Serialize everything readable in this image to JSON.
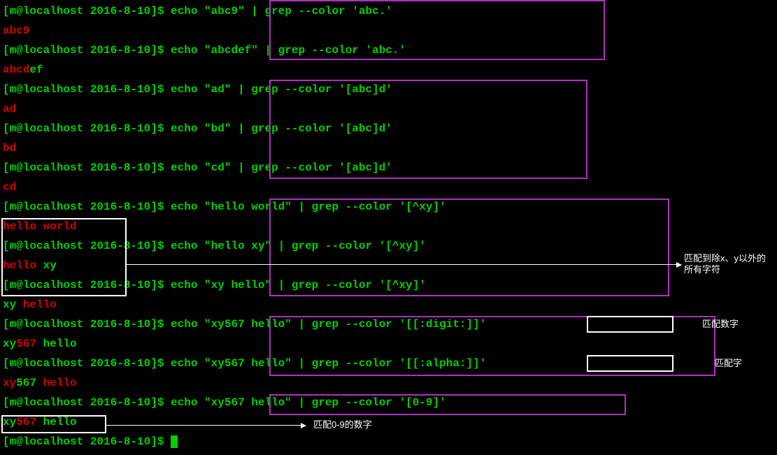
{
  "prompt": "[m@localhost 2016-8-10]$ ",
  "lines": [
    {
      "type": "cmd",
      "text": "echo \"abc9\" | grep --color 'abc.'"
    },
    {
      "type": "out",
      "parts": [
        {
          "t": "abc9",
          "c": "match"
        }
      ]
    },
    {
      "type": "cmd",
      "text": "echo \"abcdef\" | grep --color 'abc.'"
    },
    {
      "type": "out",
      "parts": [
        {
          "t": "abcd",
          "c": "match"
        },
        {
          "t": "ef",
          "c": "cmd"
        }
      ]
    },
    {
      "type": "cmd",
      "text": "echo \"ad\" | grep --color '[abc]d'"
    },
    {
      "type": "out",
      "parts": [
        {
          "t": "ad",
          "c": "match"
        }
      ]
    },
    {
      "type": "cmd",
      "text": "echo \"bd\" | grep --color '[abc]d'"
    },
    {
      "type": "out",
      "parts": [
        {
          "t": "bd",
          "c": "match"
        }
      ]
    },
    {
      "type": "cmd",
      "text": "echo \"cd\" | grep --color '[abc]d'"
    },
    {
      "type": "out",
      "parts": [
        {
          "t": "cd",
          "c": "match"
        }
      ]
    },
    {
      "type": "cmd",
      "text": "echo \"hello world\" | grep --color '[^xy]'"
    },
    {
      "type": "out",
      "parts": [
        {
          "t": "hello world",
          "c": "match"
        }
      ]
    },
    {
      "type": "cmd",
      "text": "echo \"hello xy\" | grep --color '[^xy]'"
    },
    {
      "type": "out",
      "parts": [
        {
          "t": "hello ",
          "c": "match"
        },
        {
          "t": "xy",
          "c": "cmd"
        }
      ]
    },
    {
      "type": "cmd",
      "text": "echo \"xy hello\" | grep --color '[^xy]'"
    },
    {
      "type": "out",
      "parts": [
        {
          "t": "xy",
          "c": "cmd"
        },
        {
          "t": " hello",
          "c": "match"
        }
      ]
    },
    {
      "type": "cmd",
      "text": "echo \"xy567 hello\" | grep --color '[[:digit:]]'"
    },
    {
      "type": "out",
      "parts": [
        {
          "t": "xy",
          "c": "cmd"
        },
        {
          "t": "567",
          "c": "match"
        },
        {
          "t": " hello",
          "c": "cmd"
        }
      ]
    },
    {
      "type": "cmd",
      "text": "echo \"xy567 hello\" | grep --color '[[:alpha:]]'"
    },
    {
      "type": "out",
      "parts": [
        {
          "t": "xy",
          "c": "match"
        },
        {
          "t": "567",
          "c": "cmd"
        },
        {
          "t": " ",
          "c": "cmd"
        },
        {
          "t": "hello",
          "c": "match"
        }
      ]
    },
    {
      "type": "cmd",
      "text": "echo \"xy567 hello\" | grep --color '[0-9]'"
    },
    {
      "type": "out",
      "parts": [
        {
          "t": "xy",
          "c": "cmd"
        },
        {
          "t": "567",
          "c": "match"
        },
        {
          "t": " hello",
          "c": "cmd"
        }
      ]
    },
    {
      "type": "cursor"
    }
  ],
  "annotations": {
    "neg": "匹配到除x、y以外的所有字符",
    "digit": "匹配数字",
    "alpha": "匹配字",
    "range": "匹配0-9的数字"
  }
}
